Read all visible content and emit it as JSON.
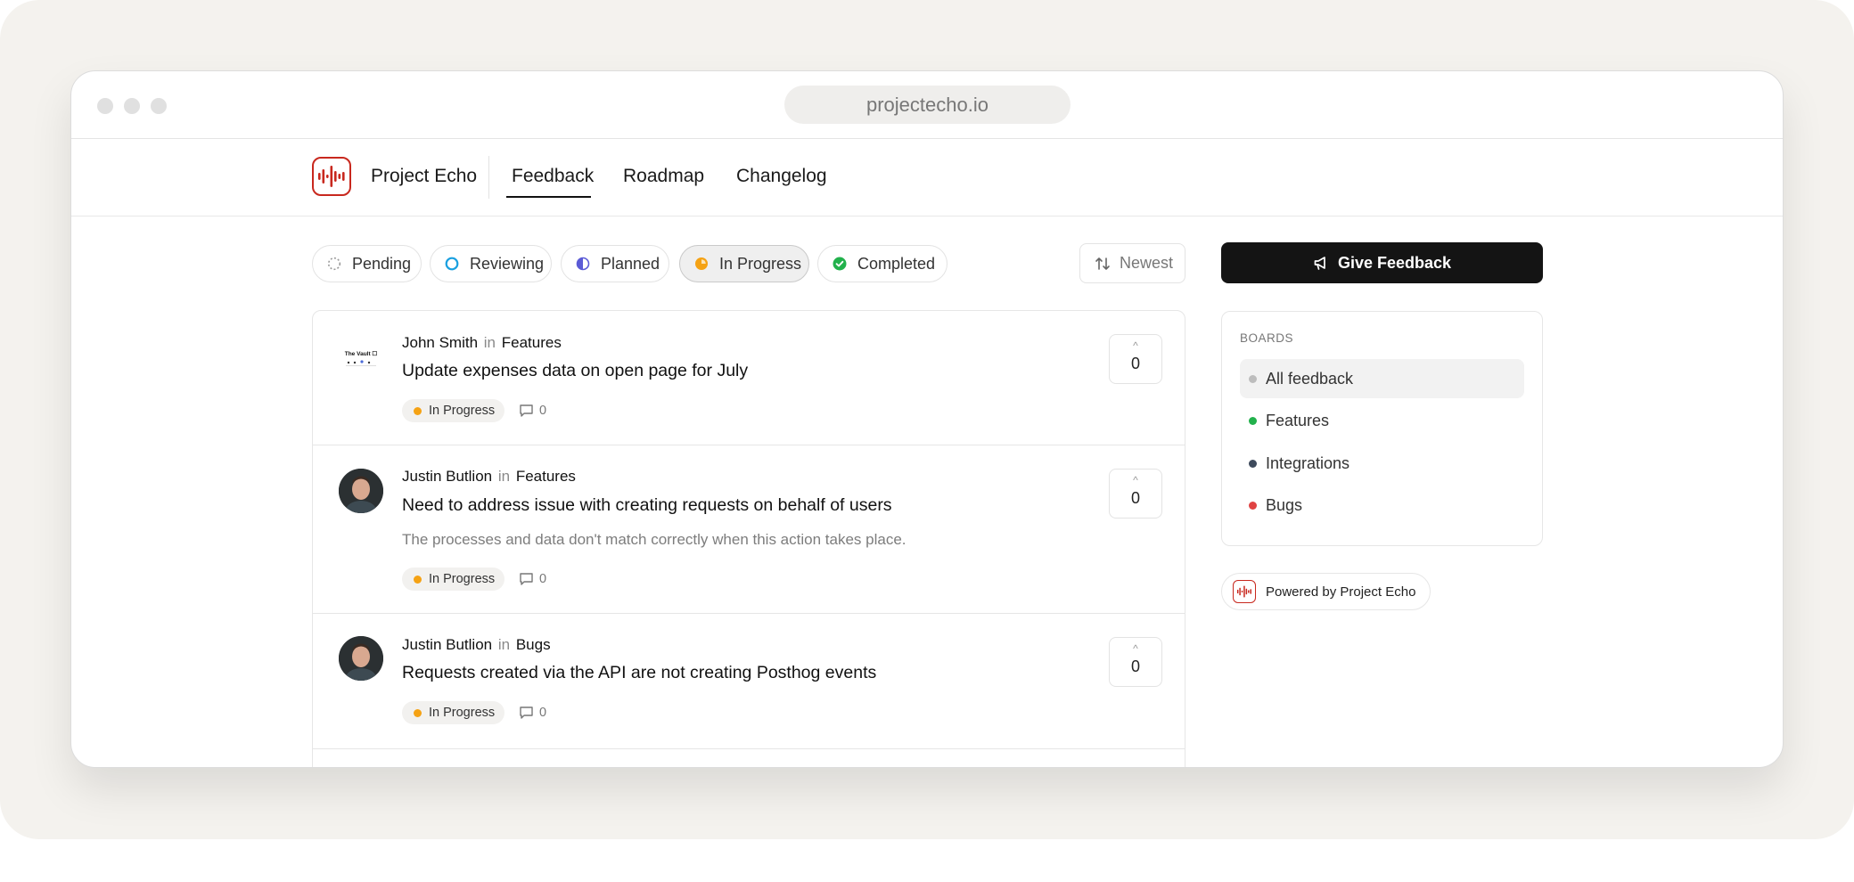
{
  "browser": {
    "url": "projectecho.io"
  },
  "nav": {
    "brand": "Project Echo",
    "links": [
      "Feedback",
      "Roadmap",
      "Changelog"
    ]
  },
  "filters": [
    {
      "label": "Pending",
      "icon": "dashed-circle-icon",
      "color": "#9a9a9a"
    },
    {
      "label": "Reviewing",
      "icon": "ring-icon",
      "color": "#1aa0e0"
    },
    {
      "label": "Planned",
      "icon": "half-circle-icon",
      "color": "#5b5bd6"
    },
    {
      "label": "In Progress",
      "icon": "progress-circle-icon",
      "color": "#f5a214",
      "active": true
    },
    {
      "label": "Completed",
      "icon": "check-circle-icon",
      "color": "#22b14c"
    }
  ],
  "sort": {
    "label": "Newest",
    "icon": "sort-arrows-icon"
  },
  "give_feedback": {
    "label": "Give Feedback",
    "icon": "megaphone-icon"
  },
  "posts": [
    {
      "author": "John Smith",
      "in": "in",
      "board": "Features",
      "title": "Update expenses data on open page for July",
      "description": "",
      "status": "In Progress",
      "comments": "0",
      "votes": "0",
      "avatar_caption": "The Vault ☐"
    },
    {
      "author": "Justin Butlion",
      "in": "in",
      "board": "Features",
      "title": "Need to address issue with creating requests on behalf of users",
      "description": "The processes and data don't match correctly when this action takes place.",
      "status": "In Progress",
      "comments": "0",
      "votes": "0"
    },
    {
      "author": "Justin Butlion",
      "in": "in",
      "board": "Bugs",
      "title": "Requests created via the API are not creating Posthog events",
      "description": "",
      "status": "In Progress",
      "comments": "0",
      "votes": "0"
    }
  ],
  "vote_caret": "^",
  "boards": {
    "heading": "BOARDS",
    "items": [
      {
        "label": "All feedback",
        "color": "#bdbdbd",
        "active": true
      },
      {
        "label": "Features",
        "color": "#22b14c"
      },
      {
        "label": "Integrations",
        "color": "#3e4a5c"
      },
      {
        "label": "Bugs",
        "color": "#e04343"
      }
    ]
  },
  "powered_by": "Powered by Project Echo",
  "colors": {
    "brand_red": "#c8281e",
    "in_progress": "#f5a214",
    "primary_button": "#141414"
  }
}
